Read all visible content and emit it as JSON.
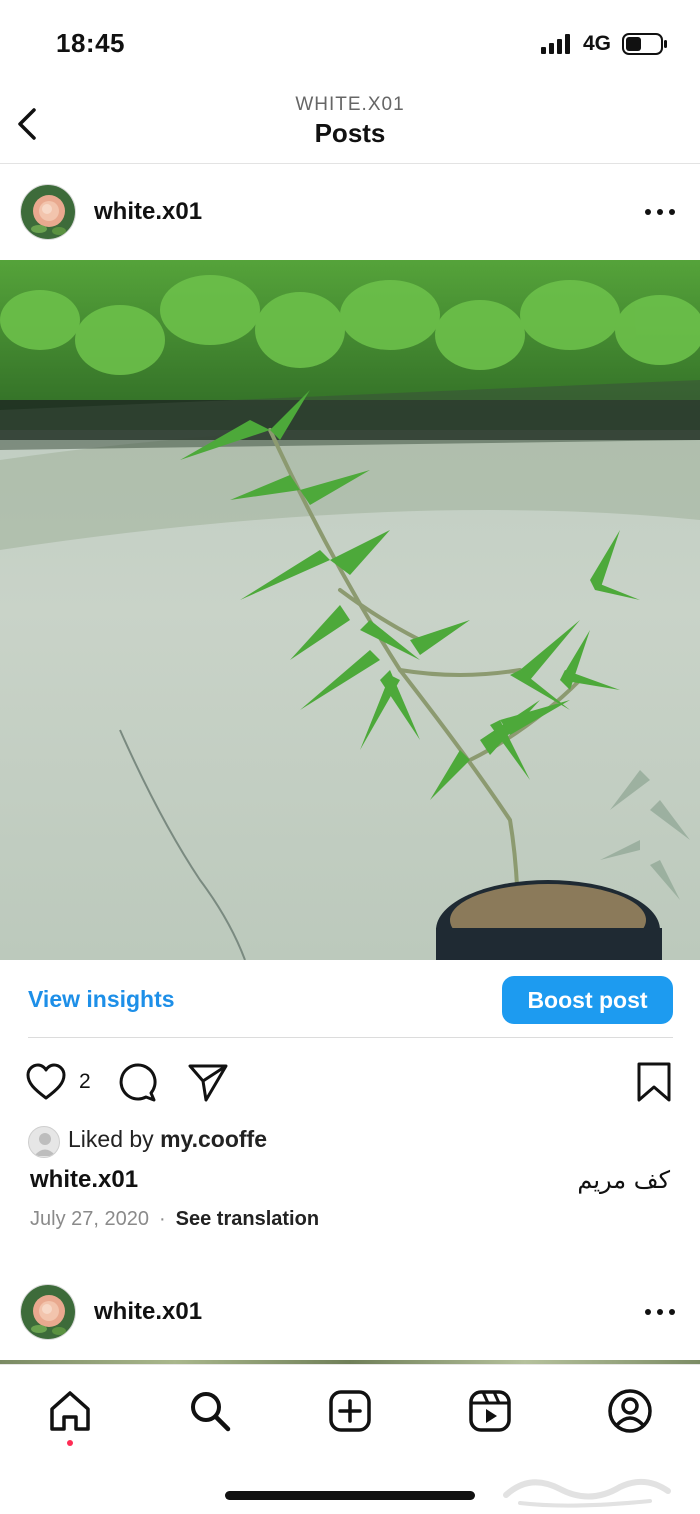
{
  "status_bar": {
    "time": "18:45",
    "network": "4G"
  },
  "nav": {
    "account": "WHITE.X01",
    "title": "Posts"
  },
  "post": {
    "username": "white.x01",
    "insights_label": "View insights",
    "boost_label": "Boost post",
    "like_count": "2",
    "liked_by_prefix": "Liked by ",
    "liked_by_user": "my.cooffe",
    "caption_user": "white.x01",
    "caption_text": "كف مريم",
    "date": "July 27, 2020",
    "separator": "·",
    "translate_label": "See translation"
  },
  "next_post": {
    "username": "white.x01"
  },
  "colors": {
    "accent_blue": "#1d9bf0",
    "link_blue": "#1d8fe8",
    "active_dot": "#ff2d55"
  },
  "icons": {
    "back": "chevron-left-icon",
    "more": "more-horizontal-icon",
    "like": "heart-icon",
    "comment": "comment-icon",
    "share": "paper-plane-icon",
    "save": "bookmark-icon",
    "tabs": [
      "home-icon",
      "search-icon",
      "create-icon",
      "reels-icon",
      "profile-icon"
    ]
  }
}
